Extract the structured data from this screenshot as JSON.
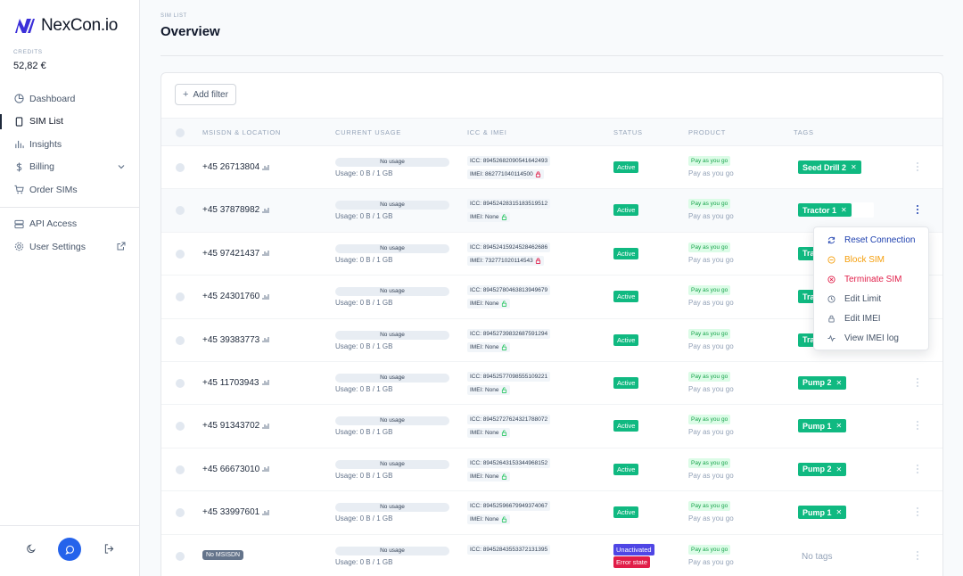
{
  "app": {
    "name": "NexCon.io"
  },
  "credits": {
    "label": "CREDITS",
    "value": "52,82 €"
  },
  "nav": {
    "items": [
      {
        "label": "Dashboard",
        "icon": "chart-pie-icon"
      },
      {
        "label": "SIM List",
        "icon": "sim-card-icon",
        "active": true
      },
      {
        "label": "Insights",
        "icon": "bar-chart-icon"
      },
      {
        "label": "Billing",
        "icon": "dollar-icon"
      },
      {
        "label": "Order SIMs",
        "icon": "cart-icon"
      }
    ],
    "items2": [
      {
        "label": "API Access",
        "icon": "server-icon"
      },
      {
        "label": "User Settings",
        "icon": "gear-icon"
      }
    ]
  },
  "header": {
    "crumb": "SIM LIST",
    "title": "Overview"
  },
  "toolbar": {
    "add_filter": "Add filter"
  },
  "table": {
    "columns": [
      "MSISDN & LOCATION",
      "CURRENT USAGE",
      "ICC & IMEI",
      "STATUS",
      "PRODUCT",
      "TAGS"
    ],
    "rows": [
      {
        "msisdn": "+45 26713804",
        "usage_badge": "No usage",
        "usage": "Usage: 0 B / 1 GB",
        "icc": "ICC: 89452682090541642493",
        "imei": "IMEI: 862771040114500",
        "imei_locked": true,
        "status": "Active",
        "product_badge": "Pay as you go",
        "product": "Pay as you go",
        "tag": "Seed Drill 2"
      },
      {
        "msisdn": "+45 37878982",
        "usage_badge": "No usage",
        "usage": "Usage: 0 B / 1 GB",
        "icc": "ICC: 89452428315183519512",
        "imei": "IMEI: None",
        "imei_locked": false,
        "status": "Active",
        "product_badge": "Pay as you go",
        "product": "Pay as you go",
        "tag": "Tractor 1"
      },
      {
        "msisdn": "+45 97421437",
        "usage_badge": "No usage",
        "usage": "Usage: 0 B / 1 GB",
        "icc": "ICC: 89452415924528462686",
        "imei": "IMEI: 732771020114543",
        "imei_locked": true,
        "status": "Active",
        "product_badge": "Pay as you go",
        "product": "Pay as you go",
        "tag": "Tra"
      },
      {
        "msisdn": "+45 24301760",
        "usage_badge": "No usage",
        "usage": "Usage: 0 B / 1 GB",
        "icc": "ICC: 89452780463813949679",
        "imei": "IMEI: None",
        "imei_locked": false,
        "status": "Active",
        "product_badge": "Pay as you go",
        "product": "Pay as you go",
        "tag": "Tra"
      },
      {
        "msisdn": "+45 39383773",
        "usage_badge": "No usage",
        "usage": "Usage: 0 B / 1 GB",
        "icc": "ICC: 89452739832687591294",
        "imei": "IMEI: None",
        "imei_locked": false,
        "status": "Active",
        "product_badge": "Pay as you go",
        "product": "Pay as you go",
        "tag": "Tra"
      },
      {
        "msisdn": "+45 11703943",
        "usage_badge": "No usage",
        "usage": "Usage: 0 B / 1 GB",
        "icc": "ICC: 89452577098555109221",
        "imei": "IMEI: None",
        "imei_locked": false,
        "status": "Active",
        "product_badge": "Pay as you go",
        "product": "Pay as you go",
        "tag": "Pump 2"
      },
      {
        "msisdn": "+45 91343702",
        "usage_badge": "No usage",
        "usage": "Usage: 0 B / 1 GB",
        "icc": "ICC: 89452727624321788072",
        "imei": "IMEI: None",
        "imei_locked": false,
        "status": "Active",
        "product_badge": "Pay as you go",
        "product": "Pay as you go",
        "tag": "Pump 1"
      },
      {
        "msisdn": "+45 66673010",
        "usage_badge": "No usage",
        "usage": "Usage: 0 B / 1 GB",
        "icc": "ICC: 89452643153344968152",
        "imei": "IMEI: None",
        "imei_locked": false,
        "status": "Active",
        "product_badge": "Pay as you go",
        "product": "Pay as you go",
        "tag": "Pump 2"
      },
      {
        "msisdn": "+45 33997601",
        "usage_badge": "No usage",
        "usage": "Usage: 0 B / 1 GB",
        "icc": "ICC: 89452596679949374067",
        "imei": "IMEI: None",
        "imei_locked": false,
        "status": "Active",
        "product_badge": "Pay as you go",
        "product": "Pay as you go",
        "tag": "Pump 1"
      },
      {
        "no_msisdn": "No MSISDN",
        "usage_badge": "No usage",
        "usage": "Usage: 0 B / 1 GB",
        "icc": "ICC: 89452843553372131395",
        "status_u": "Unactivated",
        "status_e": "Error state",
        "product_badge": "Pay as you go",
        "product": "Pay as you go",
        "no_tags": "No tags"
      }
    ]
  },
  "menu": {
    "items": [
      {
        "label": "Reset Connection",
        "color": "#1e40af",
        "icon": "refresh-icon"
      },
      {
        "label": "Block SIM",
        "color": "#f59e0b",
        "icon": "block-icon"
      },
      {
        "label": "Terminate SIM",
        "color": "#e11d48",
        "icon": "x-circle-icon"
      },
      {
        "label": "Edit Limit",
        "color": "#475569",
        "icon": "clock-icon"
      },
      {
        "label": "Edit IMEI",
        "color": "#475569",
        "icon": "lock-icon"
      },
      {
        "label": "View IMEI log",
        "color": "#475569",
        "icon": "activity-icon"
      }
    ]
  },
  "colors": {
    "accent": "#2563eb",
    "active": "#10b981",
    "tag": "#10b981"
  }
}
